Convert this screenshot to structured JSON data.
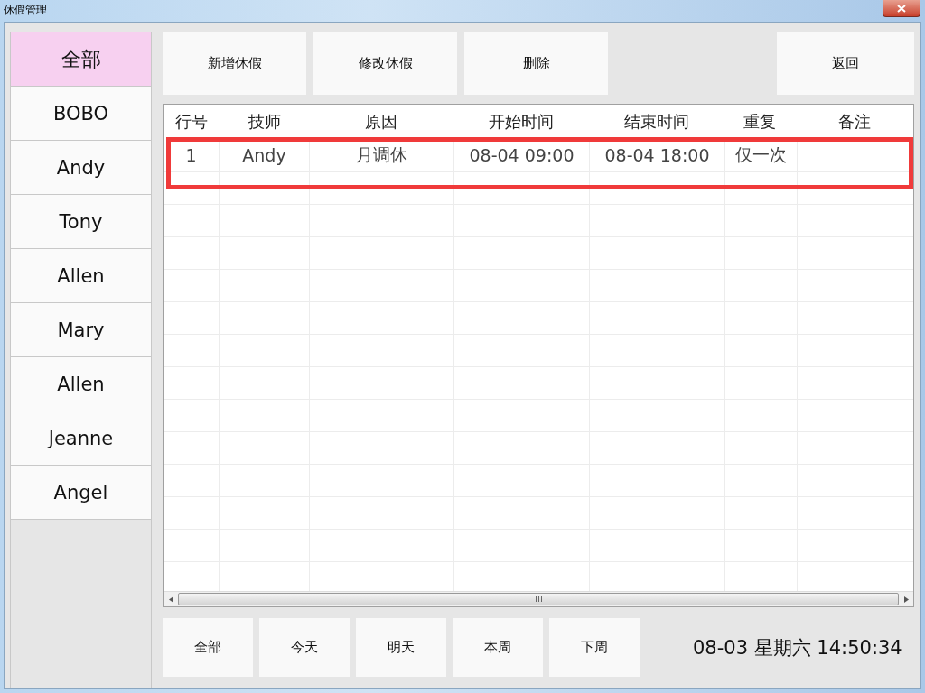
{
  "window": {
    "title": "休假管理"
  },
  "sidebar": {
    "items": [
      {
        "label": "全部",
        "selected": true
      },
      {
        "label": "BOBO",
        "selected": false
      },
      {
        "label": "Andy",
        "selected": false
      },
      {
        "label": "Tony",
        "selected": false
      },
      {
        "label": "Allen",
        "selected": false
      },
      {
        "label": "Mary",
        "selected": false
      },
      {
        "label": "Allen",
        "selected": false
      },
      {
        "label": "Jeanne",
        "selected": false
      },
      {
        "label": "Angel",
        "selected": false
      }
    ]
  },
  "toolbar": {
    "buttons": [
      "新增休假",
      "修改休假",
      "删除"
    ],
    "back_button": "返回"
  },
  "table": {
    "columns": [
      "行号",
      "技师",
      "原因",
      "开始时间",
      "结束时间",
      "重复",
      "备注"
    ],
    "rows": [
      {
        "cells": [
          "1",
          "Andy",
          "月调休",
          "08-04 09:00",
          "08-04 18:00",
          "仅一次",
          ""
        ],
        "highlighted": true
      }
    ]
  },
  "filters": [
    {
      "label": "全部"
    },
    {
      "label": "今天"
    },
    {
      "label": "明天"
    },
    {
      "label": "本周"
    },
    {
      "label": "下周"
    }
  ],
  "status": {
    "datetime": "08-03 星期六 14:50:34"
  }
}
